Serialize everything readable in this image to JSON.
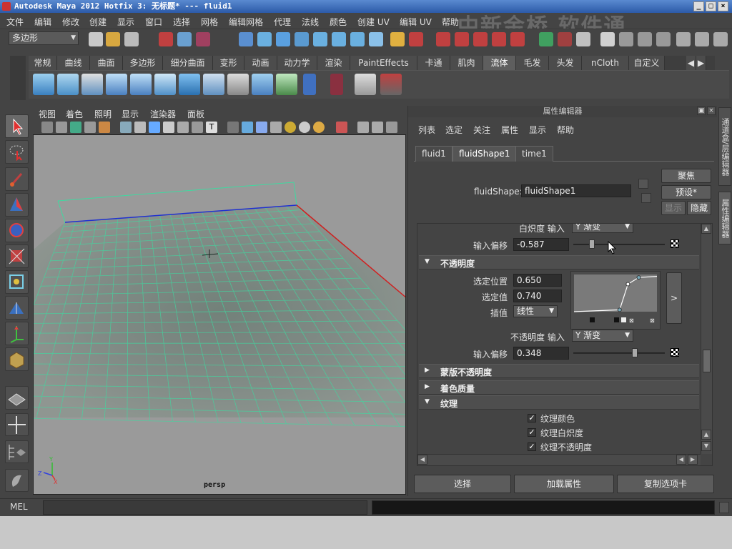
{
  "window": {
    "title": "Autodesk Maya 2012 Hotfix 3: 无标题*   ---   fluid1"
  },
  "menubar": [
    "文件",
    "编辑",
    "修改",
    "创建",
    "显示",
    "窗口",
    "选择",
    "网格",
    "编辑网格",
    "代理",
    "法线",
    "颜色",
    "创建 UV",
    "编辑 UV",
    "帮助"
  ],
  "watermark": "中新金桥  软件通",
  "status_line": {
    "mode_menu": "多边形"
  },
  "shelf": {
    "tabs": [
      "常规",
      "曲线",
      "曲面",
      "多边形",
      "细分曲面",
      "变形",
      "动画",
      "动力学",
      "渲染",
      "PaintEffects",
      "卡通",
      "肌肉",
      "流体",
      "毛发",
      "头发",
      "nCloth",
      "自定义"
    ],
    "active_tab": "流体"
  },
  "viewport": {
    "menu": [
      "视图",
      "着色",
      "照明",
      "显示",
      "渲染器",
      "面板"
    ],
    "camera_label": "persp"
  },
  "attribute_editor": {
    "title": "属性编辑器",
    "menu": [
      "列表",
      "选定",
      "关注",
      "属性",
      "显示",
      "帮助"
    ],
    "tabs": [
      "fluid1",
      "fluidShape1",
      "time1"
    ],
    "active_tab": "fluidShape1",
    "node_label": "fluidShape:",
    "node_value": "fluidShape1",
    "buttons": {
      "focus": "聚焦",
      "presets": "预设*",
      "show": "显示",
      "hide": "隐藏"
    },
    "incandescence_input_label": "白炽度 输入",
    "incandescence_input_value": "Y 渐变",
    "input_bias_label": "输入偏移",
    "incandescence_input_bias": "-0.587",
    "opacity_section": "不透明度",
    "selected_position_label": "选定位置",
    "selected_position": "0.650",
    "selected_value_label": "选定值",
    "selected_value": "0.740",
    "interpolation_label": "插值",
    "interpolation": "线性",
    "ramp_expand": ">",
    "opacity_input_label": "不透明度 输入",
    "opacity_input_value": "Y 渐变",
    "opacity_input_bias": "0.348",
    "sections": {
      "matte_opacity": "蒙版不透明度",
      "shading_quality": "着色质量",
      "textures": "纹理"
    },
    "checkboxes": [
      {
        "label": "纹理颜色",
        "checked": true
      },
      {
        "label": "纹理白炽度",
        "checked": true
      },
      {
        "label": "纹理不透明度",
        "checked": true
      }
    ],
    "bottom_buttons": {
      "select": "选择",
      "load_attributes": "加载属性",
      "copy_tab": "复制选项卡"
    },
    "slider_levels": {
      "incandescence_input_bias": 0.2,
      "opacity_input_bias": 0.67
    },
    "ramp_points": [
      [
        0.0,
        0.0
      ],
      [
        0.55,
        0.05
      ],
      [
        0.65,
        0.74
      ],
      [
        0.78,
        0.92
      ],
      [
        1.0,
        0.95
      ]
    ]
  },
  "right_dock": {
    "tab1": "通道盒/层编辑器",
    "tab2": "属性编辑器"
  },
  "command_line": {
    "label": "MEL"
  },
  "colors": {
    "panel_bg": "#444444",
    "viewport_bg": "#9a9a9a",
    "grid_green": "#3fd9a0"
  }
}
